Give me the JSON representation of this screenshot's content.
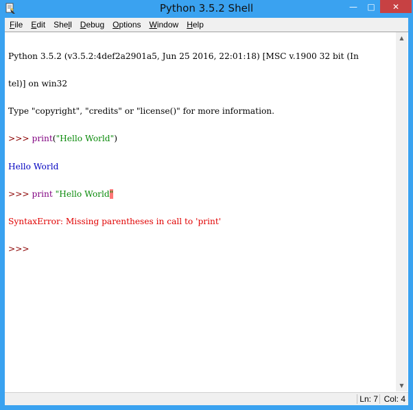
{
  "window": {
    "title": "Python 3.5.2 Shell",
    "minimize_glyph": "—",
    "maximize_glyph": "□",
    "close_glyph": "✕"
  },
  "menu": [
    {
      "label_pre": "",
      "label_key": "F",
      "label_post": "ile"
    },
    {
      "label_pre": "",
      "label_key": "E",
      "label_post": "dit"
    },
    {
      "label_pre": "She",
      "label_key": "l",
      "label_post": "l"
    },
    {
      "label_pre": "",
      "label_key": "D",
      "label_post": "ebug"
    },
    {
      "label_pre": "",
      "label_key": "O",
      "label_post": "ptions"
    },
    {
      "label_pre": "",
      "label_key": "W",
      "label_post": "indow"
    },
    {
      "label_pre": "",
      "label_key": "H",
      "label_post": "elp"
    }
  ],
  "shell": {
    "banner_line1": "Python 3.5.2 (v3.5.2:4def2a2901a5, Jun 25 2016, 22:01:18) [MSC v.1900 32 bit (In",
    "banner_line2": "tel)] on win32",
    "banner_line3": "Type \"copyright\", \"credits\" or \"license()\" for more information.",
    "prompt": ">>> ",
    "cmd1_func": "print",
    "cmd1_open": "(",
    "cmd1_string": "\"Hello World\"",
    "cmd1_close": ")",
    "output1": "Hello World",
    "cmd2_func": "print",
    "cmd2_string": " \"Hello World",
    "cmd2_mark": "\"",
    "error": "SyntaxError: Missing parentheses in call to 'print'",
    "final_prompt": ">>>"
  },
  "status": {
    "ln": "Ln: 7",
    "col": "Col: 4"
  },
  "colors": {
    "titlebar": "#3aa2f0",
    "close_button": "#c74143",
    "error_text": "#e00000",
    "string_text": "#0a8a0a",
    "output_text": "#0000c0",
    "keyword_text": "#7a1fa2"
  }
}
